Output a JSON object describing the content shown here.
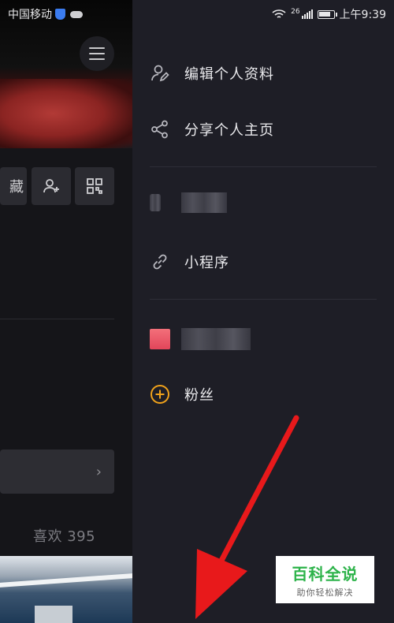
{
  "status_bar": {
    "carrier": "中国移动",
    "network": "26",
    "time": "上午9:39"
  },
  "profile": {
    "favorites_tab_partial": "藏",
    "likes_label": "喜欢 395"
  },
  "drawer": {
    "items": [
      {
        "label": "编辑个人资料",
        "icon": "user-edit-icon"
      },
      {
        "label": "分享个人主页",
        "icon": "share-icon"
      },
      {
        "label": "小程序",
        "icon": "link-icon"
      },
      {
        "label": "粉丝",
        "icon": "plus-circle-icon"
      }
    ]
  },
  "watermark": {
    "title": "百科全说",
    "subtitle": "助你轻松解决"
  },
  "colors": {
    "drawer_bg": "#1e1e26",
    "accent_orange": "#f0a21b",
    "arrow_red": "#e8191b",
    "watermark_green": "#2db34a"
  }
}
